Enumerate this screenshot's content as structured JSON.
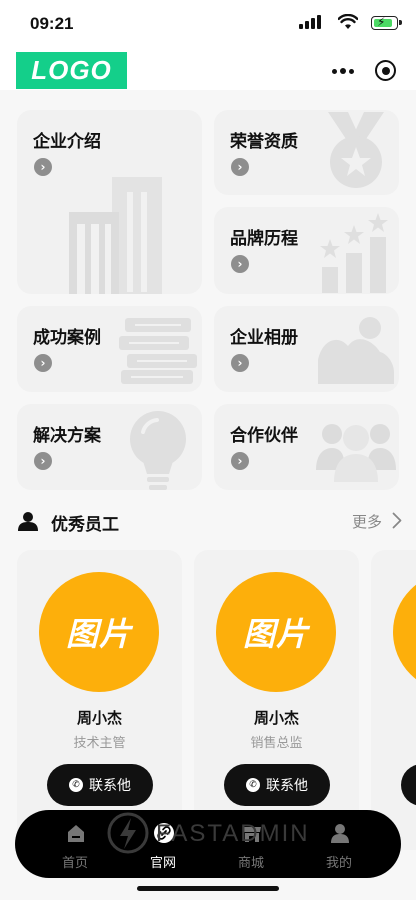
{
  "status_bar": {
    "time": "09:21"
  },
  "header": {
    "logo_text": "LOGO"
  },
  "grid": [
    {
      "id": "intro",
      "title": "企业介绍",
      "icon": "building-icon"
    },
    {
      "id": "honor",
      "title": "荣誉资质",
      "icon": "medal-icon"
    },
    {
      "id": "history",
      "title": "品牌历程",
      "icon": "stars-chart-icon"
    },
    {
      "id": "cases",
      "title": "成功案例",
      "icon": "books-icon"
    },
    {
      "id": "album",
      "title": "企业相册",
      "icon": "picture-icon"
    },
    {
      "id": "solution",
      "title": "解决方案",
      "icon": "lightbulb-icon"
    },
    {
      "id": "partner",
      "title": "合作伙伴",
      "icon": "group-icon"
    }
  ],
  "employees": {
    "section_title": "优秀员工",
    "more_label": "更多",
    "list": [
      {
        "avatar_text": "图片",
        "name": "周小杰",
        "role": "技术主管",
        "contact_label": "联系他"
      },
      {
        "avatar_text": "图片",
        "name": "周小杰",
        "role": "销售总监",
        "contact_label": "联系他"
      }
    ]
  },
  "tabbar": {
    "active": "官网",
    "items": [
      {
        "label": "首页",
        "icon": "home-icon"
      },
      {
        "label": "官网",
        "icon": "link-icon"
      },
      {
        "label": "商城",
        "icon": "shop-icon"
      },
      {
        "label": "我的",
        "icon": "user-icon"
      }
    ],
    "watermark": "FASTADMIN"
  },
  "colors": {
    "brand": "#14cf8a",
    "avatar": "#fdaf0b",
    "tabbar": "#000000"
  }
}
